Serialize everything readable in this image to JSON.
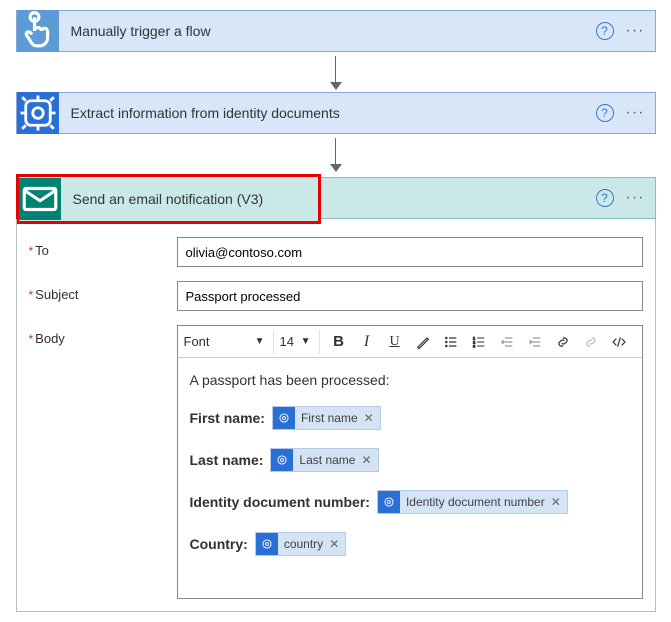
{
  "steps": {
    "s1": {
      "title": "Manually trigger a flow"
    },
    "s2": {
      "title": "Extract information from identity documents"
    },
    "s3": {
      "title": "Send an email notification (V3)"
    }
  },
  "form": {
    "to_label": "To",
    "subject_label": "Subject",
    "body_label": "Body",
    "to_value": "olivia@contoso.com",
    "subject_value": "Passport processed"
  },
  "toolbar": {
    "font_label": "Font",
    "size_label": "14"
  },
  "body_content": {
    "intro": "A passport has been processed:",
    "rows": {
      "first_name_label": "First name:",
      "first_name_token": "First name",
      "last_name_label": "Last name:",
      "last_name_token": "Last name",
      "doc_label": "Identity document number:",
      "doc_token": "Identity document number",
      "country_label": "Country:",
      "country_token": "country"
    }
  }
}
